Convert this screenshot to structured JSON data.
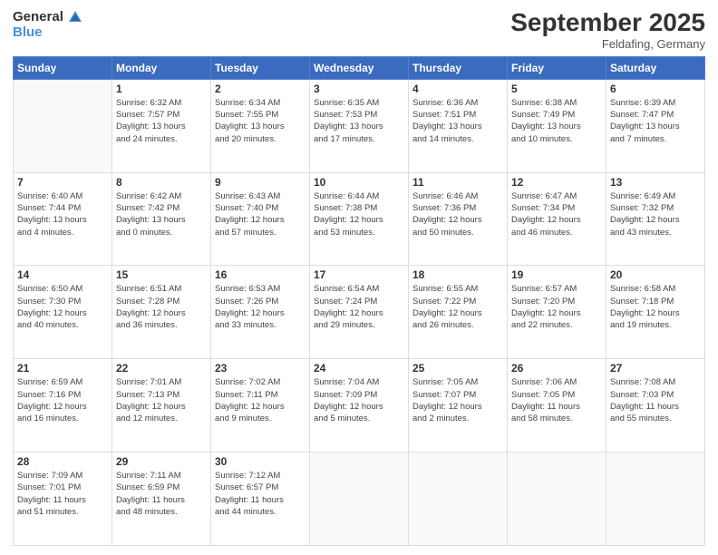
{
  "logo": {
    "general": "General",
    "blue": "Blue"
  },
  "title": {
    "month": "September 2025",
    "location": "Feldafing, Germany"
  },
  "weekdays": [
    "Sunday",
    "Monday",
    "Tuesday",
    "Wednesday",
    "Thursday",
    "Friday",
    "Saturday"
  ],
  "weeks": [
    [
      {
        "day": "",
        "info": ""
      },
      {
        "day": "1",
        "info": "Sunrise: 6:32 AM\nSunset: 7:57 PM\nDaylight: 13 hours\nand 24 minutes."
      },
      {
        "day": "2",
        "info": "Sunrise: 6:34 AM\nSunset: 7:55 PM\nDaylight: 13 hours\nand 20 minutes."
      },
      {
        "day": "3",
        "info": "Sunrise: 6:35 AM\nSunset: 7:53 PM\nDaylight: 13 hours\nand 17 minutes."
      },
      {
        "day": "4",
        "info": "Sunrise: 6:36 AM\nSunset: 7:51 PM\nDaylight: 13 hours\nand 14 minutes."
      },
      {
        "day": "5",
        "info": "Sunrise: 6:38 AM\nSunset: 7:49 PM\nDaylight: 13 hours\nand 10 minutes."
      },
      {
        "day": "6",
        "info": "Sunrise: 6:39 AM\nSunset: 7:47 PM\nDaylight: 13 hours\nand 7 minutes."
      }
    ],
    [
      {
        "day": "7",
        "info": "Sunrise: 6:40 AM\nSunset: 7:44 PM\nDaylight: 13 hours\nand 4 minutes."
      },
      {
        "day": "8",
        "info": "Sunrise: 6:42 AM\nSunset: 7:42 PM\nDaylight: 13 hours\nand 0 minutes."
      },
      {
        "day": "9",
        "info": "Sunrise: 6:43 AM\nSunset: 7:40 PM\nDaylight: 12 hours\nand 57 minutes."
      },
      {
        "day": "10",
        "info": "Sunrise: 6:44 AM\nSunset: 7:38 PM\nDaylight: 12 hours\nand 53 minutes."
      },
      {
        "day": "11",
        "info": "Sunrise: 6:46 AM\nSunset: 7:36 PM\nDaylight: 12 hours\nand 50 minutes."
      },
      {
        "day": "12",
        "info": "Sunrise: 6:47 AM\nSunset: 7:34 PM\nDaylight: 12 hours\nand 46 minutes."
      },
      {
        "day": "13",
        "info": "Sunrise: 6:49 AM\nSunset: 7:32 PM\nDaylight: 12 hours\nand 43 minutes."
      }
    ],
    [
      {
        "day": "14",
        "info": "Sunrise: 6:50 AM\nSunset: 7:30 PM\nDaylight: 12 hours\nand 40 minutes."
      },
      {
        "day": "15",
        "info": "Sunrise: 6:51 AM\nSunset: 7:28 PM\nDaylight: 12 hours\nand 36 minutes."
      },
      {
        "day": "16",
        "info": "Sunrise: 6:53 AM\nSunset: 7:26 PM\nDaylight: 12 hours\nand 33 minutes."
      },
      {
        "day": "17",
        "info": "Sunrise: 6:54 AM\nSunset: 7:24 PM\nDaylight: 12 hours\nand 29 minutes."
      },
      {
        "day": "18",
        "info": "Sunrise: 6:55 AM\nSunset: 7:22 PM\nDaylight: 12 hours\nand 26 minutes."
      },
      {
        "day": "19",
        "info": "Sunrise: 6:57 AM\nSunset: 7:20 PM\nDaylight: 12 hours\nand 22 minutes."
      },
      {
        "day": "20",
        "info": "Sunrise: 6:58 AM\nSunset: 7:18 PM\nDaylight: 12 hours\nand 19 minutes."
      }
    ],
    [
      {
        "day": "21",
        "info": "Sunrise: 6:59 AM\nSunset: 7:16 PM\nDaylight: 12 hours\nand 16 minutes."
      },
      {
        "day": "22",
        "info": "Sunrise: 7:01 AM\nSunset: 7:13 PM\nDaylight: 12 hours\nand 12 minutes."
      },
      {
        "day": "23",
        "info": "Sunrise: 7:02 AM\nSunset: 7:11 PM\nDaylight: 12 hours\nand 9 minutes."
      },
      {
        "day": "24",
        "info": "Sunrise: 7:04 AM\nSunset: 7:09 PM\nDaylight: 12 hours\nand 5 minutes."
      },
      {
        "day": "25",
        "info": "Sunrise: 7:05 AM\nSunset: 7:07 PM\nDaylight: 12 hours\nand 2 minutes."
      },
      {
        "day": "26",
        "info": "Sunrise: 7:06 AM\nSunset: 7:05 PM\nDaylight: 11 hours\nand 58 minutes."
      },
      {
        "day": "27",
        "info": "Sunrise: 7:08 AM\nSunset: 7:03 PM\nDaylight: 11 hours\nand 55 minutes."
      }
    ],
    [
      {
        "day": "28",
        "info": "Sunrise: 7:09 AM\nSunset: 7:01 PM\nDaylight: 11 hours\nand 51 minutes."
      },
      {
        "day": "29",
        "info": "Sunrise: 7:11 AM\nSunset: 6:59 PM\nDaylight: 11 hours\nand 48 minutes."
      },
      {
        "day": "30",
        "info": "Sunrise: 7:12 AM\nSunset: 6:57 PM\nDaylight: 11 hours\nand 44 minutes."
      },
      {
        "day": "",
        "info": ""
      },
      {
        "day": "",
        "info": ""
      },
      {
        "day": "",
        "info": ""
      },
      {
        "day": "",
        "info": ""
      }
    ]
  ]
}
